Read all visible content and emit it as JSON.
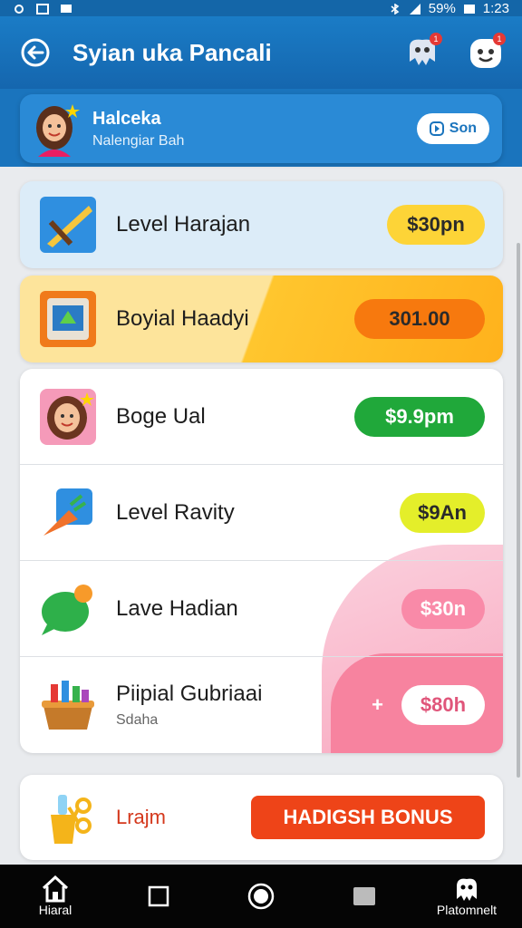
{
  "status_bar": {
    "battery": "59%",
    "time": "1:23"
  },
  "header": {
    "title": "Syian uka Pancali"
  },
  "profile": {
    "name": "Halceka",
    "subtitle": "Nalengiar Bah",
    "button_label": "Son"
  },
  "items": [
    {
      "label": "Level Harajan",
      "price": "$30pn",
      "price_bg": "#fdd437",
      "price_fg": "#2a2a2a"
    },
    {
      "label": "Boyial Haadyi",
      "price": "301.00",
      "price_bg": "#f7790e",
      "price_fg": "#2a2a2a"
    },
    {
      "label": "Boge Ual",
      "price": "$9.9pm",
      "price_bg": "#20a83a",
      "price_fg": "#ffffff"
    },
    {
      "label": "Level Ravity",
      "price": "$9An",
      "price_bg": "#e4ee2a",
      "price_fg": "#2a2a2a"
    },
    {
      "label": "Lave Hadian",
      "price": "$30n",
      "price_bg": "#f98aa8",
      "price_fg": "#ffffff"
    },
    {
      "label": "Piipial Gubriaai",
      "sublabel": "Sdaha",
      "price": "$80h",
      "price_bg": "#ffffff",
      "price_fg": "#e0557a",
      "prefix": "+"
    }
  ],
  "bonus": {
    "label": "Lrajm",
    "button_label": "HADIGSH BONUS"
  },
  "nav": [
    {
      "label": "Hiaral",
      "icon": "home-icon"
    },
    {
      "label": "",
      "icon": "square-icon"
    },
    {
      "label": "",
      "icon": "circle-icon"
    },
    {
      "label": "",
      "icon": "recent-icon"
    },
    {
      "label": "Platomnelt",
      "icon": "mascot-icon"
    }
  ],
  "colors": {
    "header": "#1a7cc6",
    "bonus_button": "#ee4418"
  }
}
